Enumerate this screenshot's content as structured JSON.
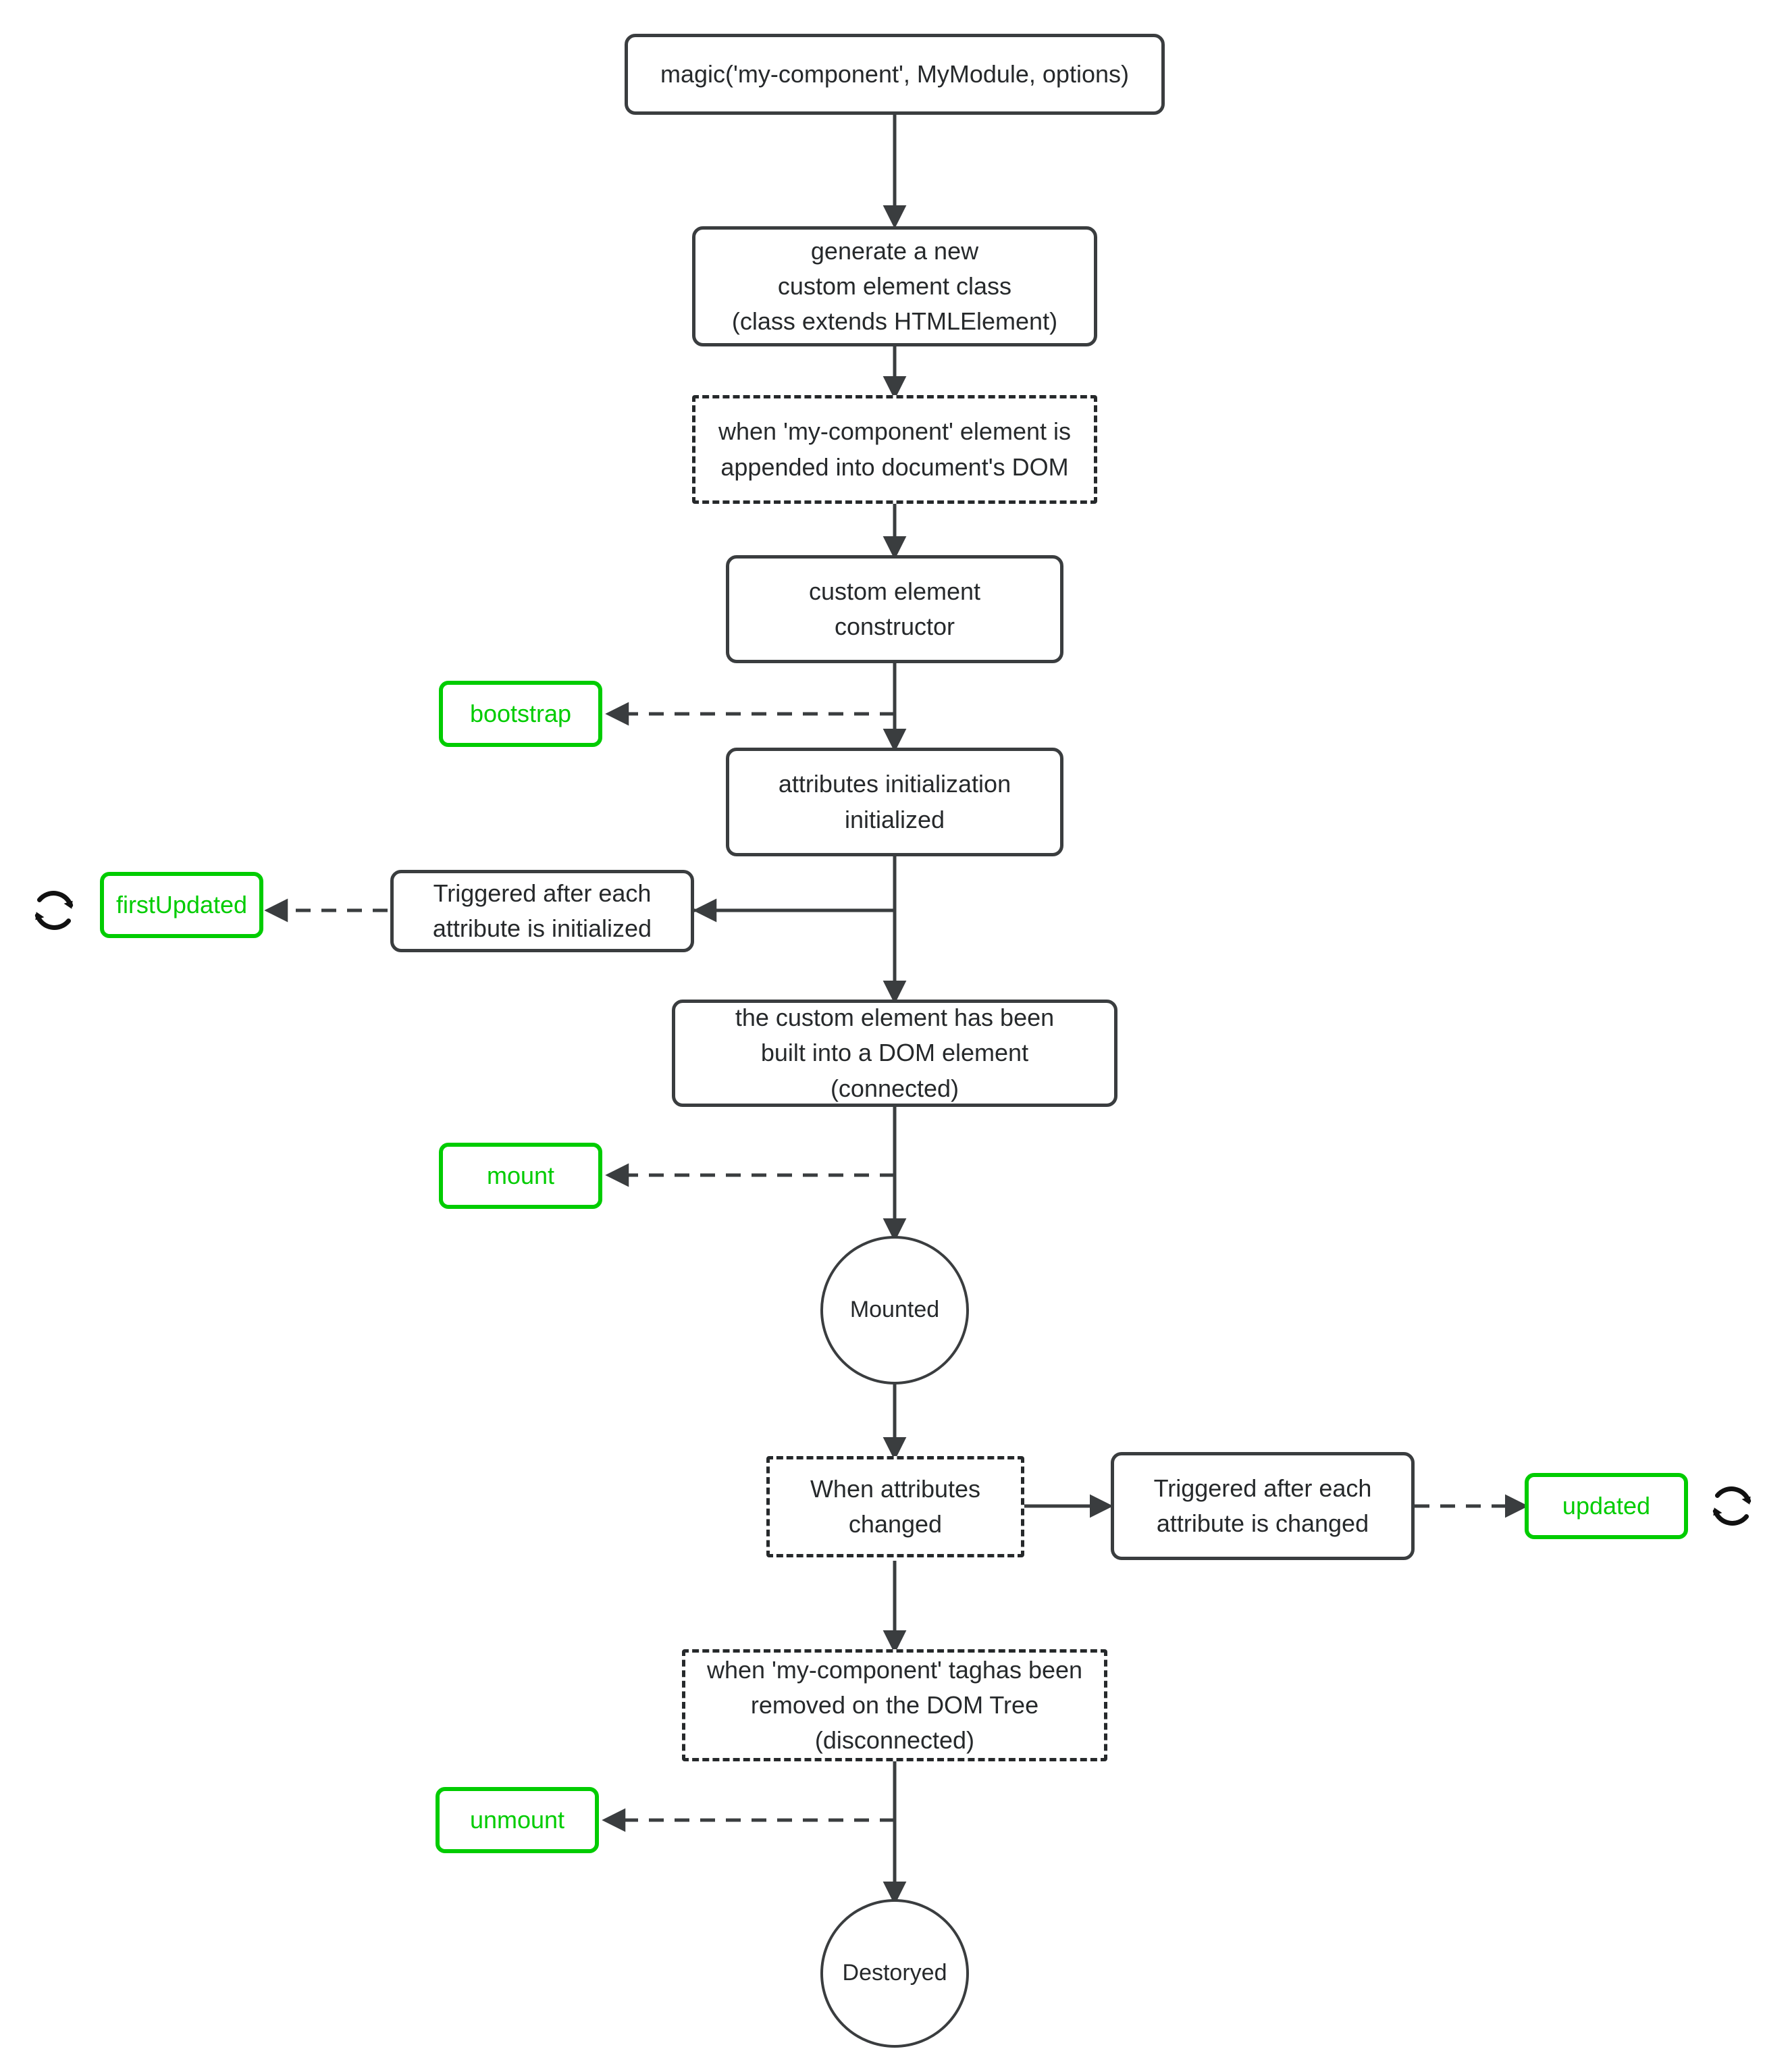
{
  "diagram": {
    "title": "Custom element lifecycle flow",
    "colors": {
      "node_border": "#3a3d3f",
      "node_text": "#26292b",
      "hook_accent": "#00cc00",
      "edge": "#3a3d3f",
      "background": "#ffffff"
    },
    "nodes": {
      "magic_call": "magic('my-component', MyModule, options)",
      "generate_class": "generate a new\ncustom element class\n(class extends HTMLElement)",
      "appended_dom": "when 'my-component' element is\nappended into document's DOM",
      "constructor": "custom element\nconstructor",
      "bootstrap": "bootstrap",
      "attributes_init": "attributes initialization\ninitialized",
      "triggered_init": "Triggered after each\nattribute is initialized",
      "first_updated": "firstUpdated",
      "connected": "the custom element has been\nbuilt into a DOM element\n(connected)",
      "mount": "mount",
      "mounted": "Mounted",
      "attributes_changed": "When attributes\nchanged",
      "triggered_changed": "Triggered after each\nattribute is changed",
      "updated": "updated",
      "disconnected": "when 'my-component' taghas been\nremoved on the DOM Tree\n(disconnected)",
      "unmount": "unmount",
      "destoryed": "Destoryed"
    },
    "icons": {
      "sync_first_updated": "sync-icon",
      "sync_updated": "sync-icon"
    }
  }
}
